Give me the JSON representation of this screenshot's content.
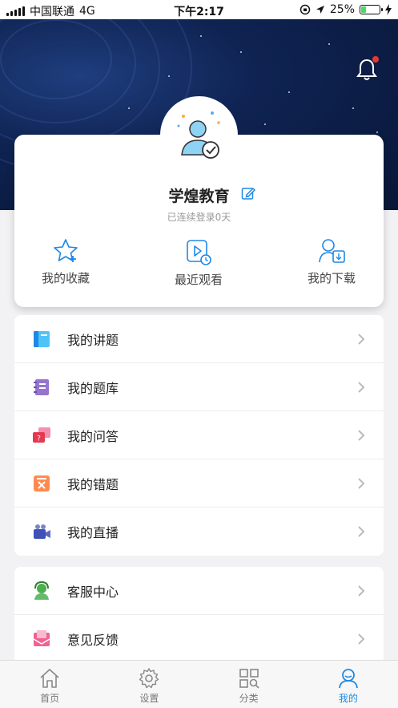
{
  "status_bar": {
    "carrier": "中国联通",
    "network": "4G",
    "time": "下午2:17",
    "battery": "25%",
    "battery_level": 0.25
  },
  "profile": {
    "username": "学煌教育",
    "login_streak": "已连续登录0天",
    "quick_actions": [
      {
        "label": "我的收藏",
        "icon": "star-plus-icon"
      },
      {
        "label": "最近观看",
        "icon": "play-clock-icon"
      },
      {
        "label": "我的下载",
        "icon": "user-download-icon"
      }
    ]
  },
  "menu_group_1": [
    {
      "label": "我的讲题",
      "icon": "book-icon"
    },
    {
      "label": "我的题库",
      "icon": "notebook-icon"
    },
    {
      "label": "我的问答",
      "icon": "chat-bubbles-icon"
    },
    {
      "label": "我的错题",
      "icon": "wrong-question-icon"
    },
    {
      "label": "我的直播",
      "icon": "video-camera-icon"
    }
  ],
  "menu_group_2": [
    {
      "label": "客服中心",
      "icon": "customer-service-icon"
    },
    {
      "label": "意见反馈",
      "icon": "feedback-icon"
    }
  ],
  "tabbar": {
    "tabs": [
      {
        "label": "首页",
        "icon": "home-icon"
      },
      {
        "label": "设置",
        "icon": "gear-icon"
      },
      {
        "label": "分类",
        "icon": "category-icon"
      },
      {
        "label": "我的",
        "icon": "user-icon"
      }
    ],
    "active_index": 3
  },
  "colors": {
    "accent": "#1e88e5",
    "hero_bg": "#0f2352",
    "badge": "#e53935"
  }
}
